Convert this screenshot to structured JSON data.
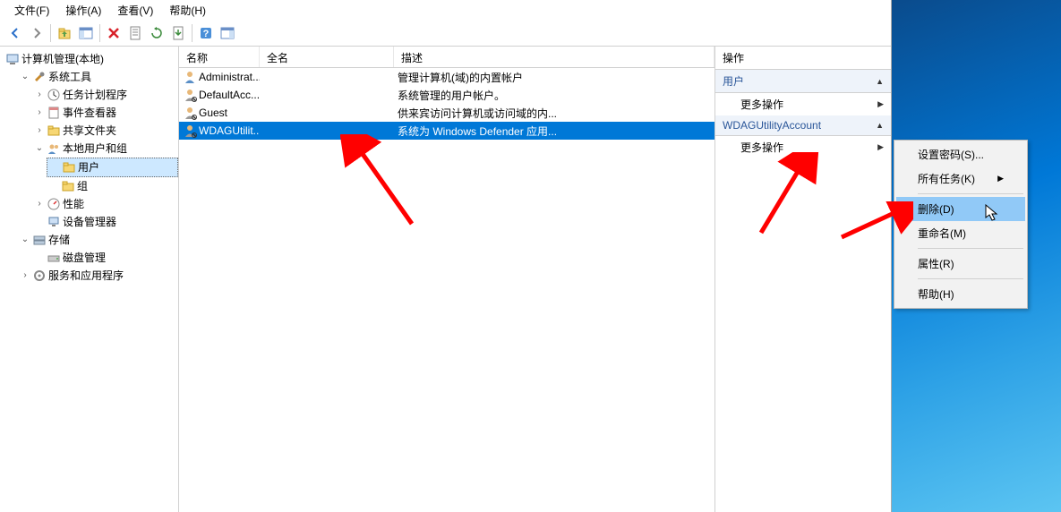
{
  "menubar": {
    "file": "文件(F)",
    "action": "操作(A)",
    "view": "查看(V)",
    "help": "帮助(H)"
  },
  "tree": {
    "root": "计算机管理(本地)",
    "system_tools": "系统工具",
    "task_scheduler": "任务计划程序",
    "event_viewer": "事件查看器",
    "shared_folders": "共享文件夹",
    "local_users_groups": "本地用户和组",
    "users": "用户",
    "groups": "组",
    "performance": "性能",
    "device_manager": "设备管理器",
    "storage": "存储",
    "disk_management": "磁盘管理",
    "services_apps": "服务和应用程序"
  },
  "list": {
    "col_name": "名称",
    "col_fullname": "全名",
    "col_desc": "描述",
    "rows": [
      {
        "name": "Administrat...",
        "full": "",
        "desc": "管理计算机(域)的内置帐户",
        "disabled": false
      },
      {
        "name": "DefaultAcc...",
        "full": "",
        "desc": "系统管理的用户帐户。",
        "disabled": true
      },
      {
        "name": "Guest",
        "full": "",
        "desc": "供来宾访问计算机或访问域的内...",
        "disabled": true
      },
      {
        "name": "WDAGUtilit...",
        "full": "",
        "desc": "系统为 Windows Defender 应用...",
        "disabled": true,
        "selected": true
      }
    ]
  },
  "actions": {
    "header": "操作",
    "group1": "用户",
    "more1": "更多操作",
    "group2": "WDAGUtilityAccount",
    "more2": "更多操作"
  },
  "context_menu": {
    "set_password": "设置密码(S)...",
    "all_tasks": "所有任务(K)",
    "delete": "删除(D)",
    "rename": "重命名(M)",
    "properties": "属性(R)",
    "help": "帮助(H)"
  }
}
